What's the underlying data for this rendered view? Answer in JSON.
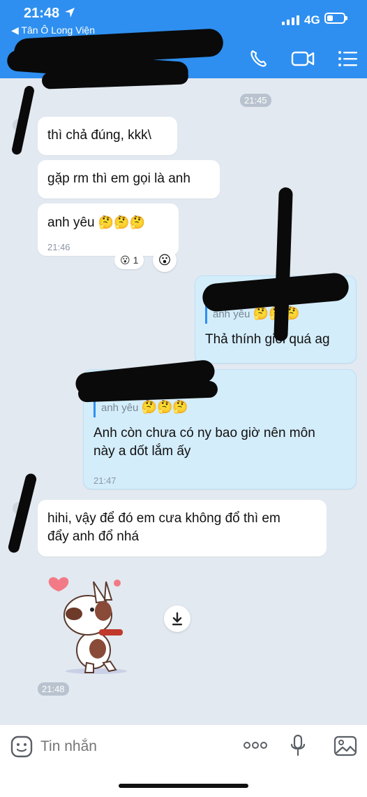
{
  "status": {
    "time": "21:48",
    "back_to_app": "◀ Tân Ô Long Viện",
    "network": "4G"
  },
  "header": {
    "title": "",
    "icons": [
      "back-arrow-icon",
      "phone-icon",
      "video-call-icon",
      "menu-list-icon"
    ]
  },
  "messages": [
    {
      "time_chip": "21:45"
    },
    {
      "from": "them",
      "text": "thì chả đúng, kkk\\"
    },
    {
      "from": "them",
      "text": "gặp rm thì em gọi là anh"
    },
    {
      "from": "them",
      "text": "anh yêu",
      "emojis": "🤔🤔🤔",
      "time": "21:46",
      "reaction": "😮",
      "reaction_count": "1",
      "react_button": "😮"
    },
    {
      "from": "me",
      "quote": "anh yêu",
      "quote_emojis": "🤔🤔🤔",
      "text": "Thả thính giỏi quá ag"
    },
    {
      "from": "me",
      "quote": "anh yêu",
      "quote_emojis": "🤔🤔🤔",
      "text_line1": "Anh còn chưa có ny bao giờ nên môn",
      "text_line2": "này a dốt lắm ấy",
      "time": "21:47"
    },
    {
      "from": "them",
      "text_line1": "hihi, vậy để đó em cưa không đổ thì em",
      "text_line2": "đẩy anh đổ nhá"
    },
    {
      "from": "them",
      "type": "sticker",
      "sticker": "dog-with-heart-sticker",
      "time": "21:48"
    }
  ],
  "composer": {
    "placeholder": "Tin nhắn",
    "icons": [
      "sticker-icon",
      "more-icon",
      "microphone-icon",
      "image-icon"
    ]
  },
  "colors": {
    "header_blue": "#2e8ff0",
    "chat_bg": "#e2e9f1",
    "my_bubble": "#d4edfb",
    "their_bubble": "#ffffff"
  }
}
